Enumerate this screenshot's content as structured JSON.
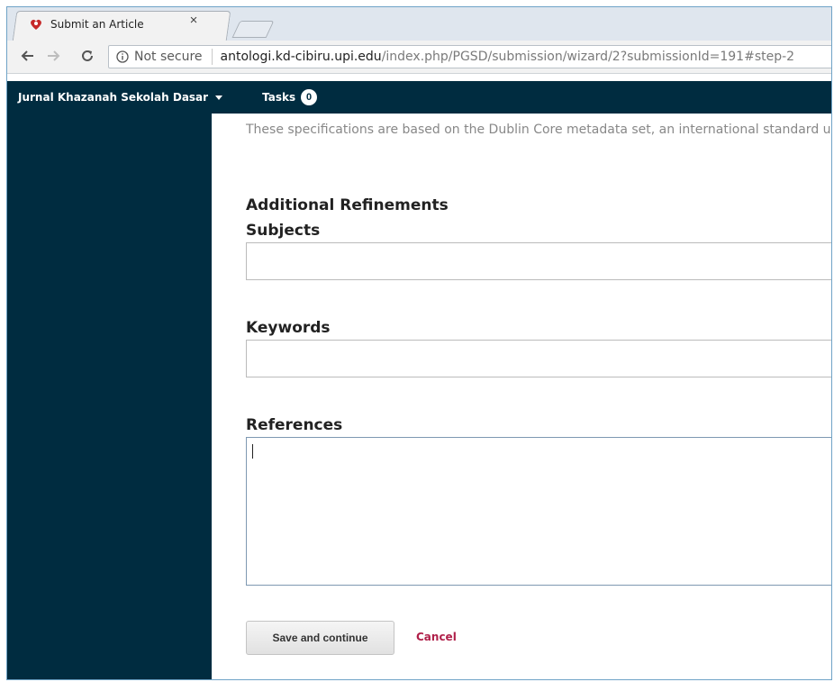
{
  "browser": {
    "tab_title": "Submit an Article",
    "tab_close": "×",
    "security_label": "Not secure",
    "url_host": "antologi.kd-cibiru.upi.edu",
    "url_path": "/index.php/PGSD/submission/wizard/2?submissionId=191#step-2"
  },
  "header": {
    "journal_name": "Jurnal Khazanah Sekolah Dasar",
    "tasks_label": "Tasks",
    "tasks_count": "0"
  },
  "form": {
    "intro": "These specifications are based on the Dublin Core metadata set, an international standard used to describe journal content.",
    "section_heading": "Additional Refinements",
    "subjects_label": "Subjects",
    "subjects_value": "",
    "keywords_label": "Keywords",
    "keywords_value": "",
    "references_label": "References",
    "references_value": "",
    "save_label": "Save and continue",
    "cancel_label": "Cancel"
  },
  "colors": {
    "navy": "#002c40",
    "cancel_red": "#b0204a"
  }
}
